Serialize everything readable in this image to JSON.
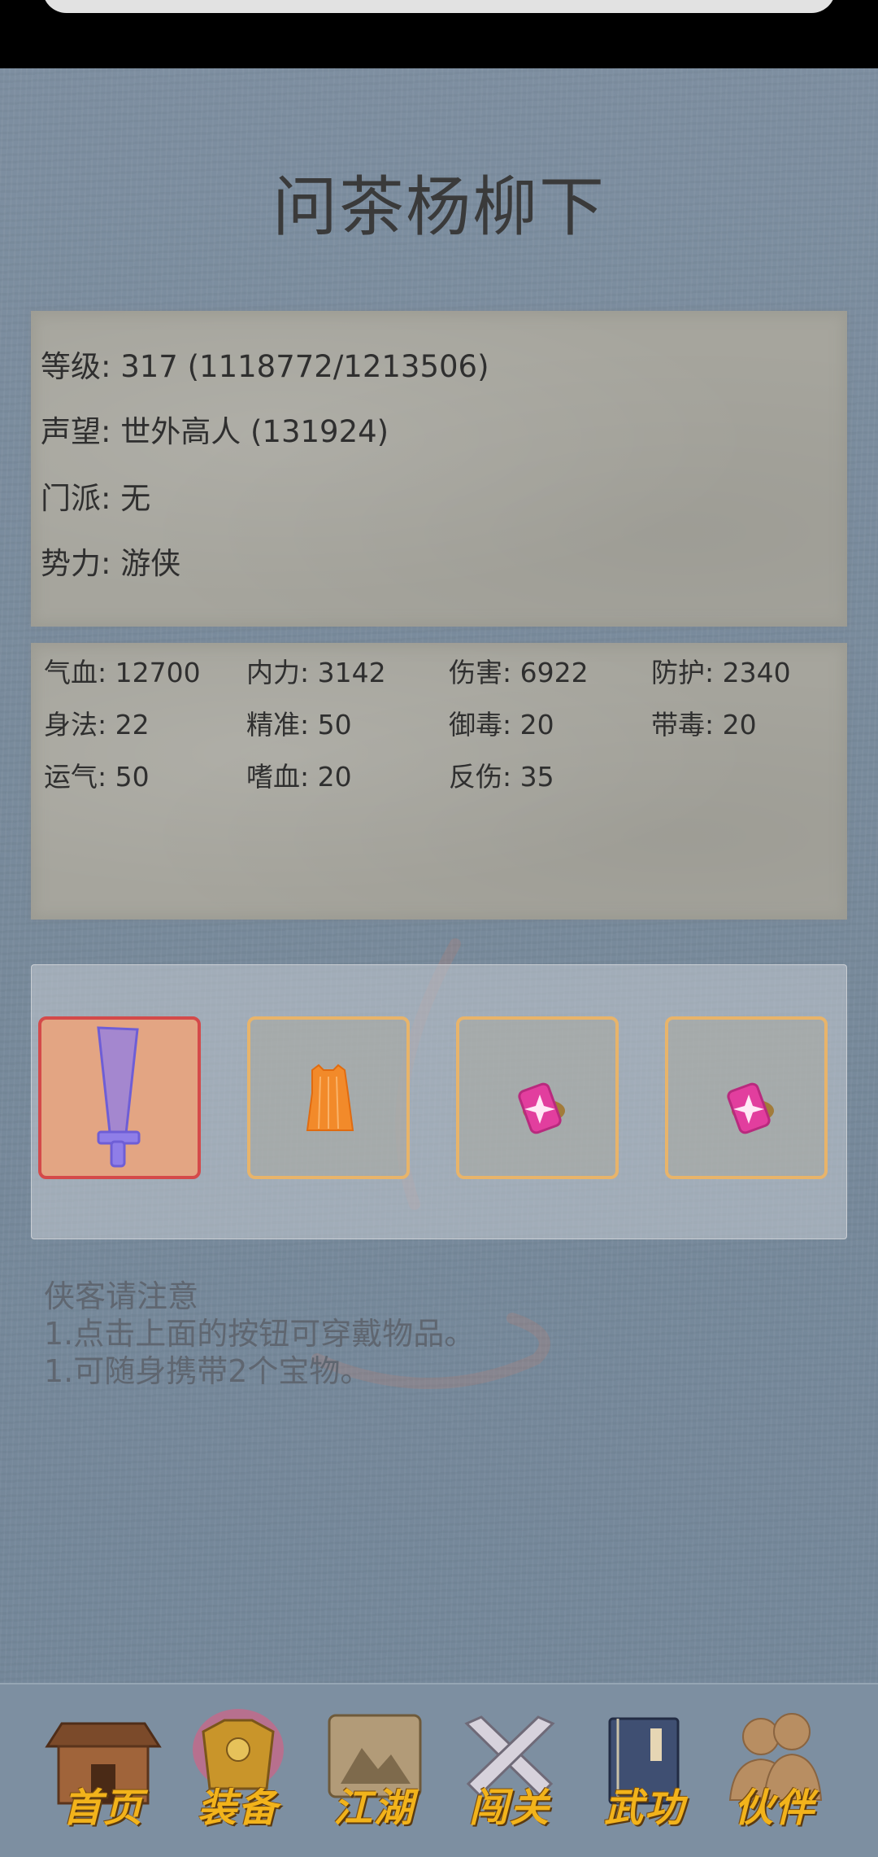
{
  "character": {
    "name": "问茶杨柳下",
    "level": "等级: 317 (1118772/1213506)",
    "prestige": "声望: 世外高人 (131924)",
    "sect": "门派: 无",
    "faction": "势力:  游侠"
  },
  "stats": [
    "气血: 12700",
    "内力: 3142",
    "伤害: 6922",
    "防护: 2340",
    "身法: 22",
    "精准: 50",
    "御毒: 20",
    "带毒: 20",
    "运气: 50",
    "嗜血: 20",
    "反伤: 35"
  ],
  "equipment": {
    "slots": [
      {
        "icon": "sword-icon",
        "active": true
      },
      {
        "icon": "armor-robe-icon",
        "active": false
      },
      {
        "icon": "treasure-gem-icon",
        "active": false
      },
      {
        "icon": "treasure-gem-icon",
        "active": false
      }
    ]
  },
  "notice": {
    "title": "侠客请注意",
    "line1": "1.点击上面的按钮可穿戴物品。",
    "line2": "1.可随身携带2个宝物。"
  },
  "nav": {
    "items": [
      {
        "label": "首页",
        "icon": "home-house-icon"
      },
      {
        "label": "装备",
        "icon": "armor-icon"
      },
      {
        "label": "江湖",
        "icon": "map-scroll-icon"
      },
      {
        "label": "闯关",
        "icon": "crossed-swords-icon"
      },
      {
        "label": "武功",
        "icon": "book-icon"
      },
      {
        "label": "伙伴",
        "icon": "partners-icon"
      }
    ]
  },
  "colors": {
    "background": "#7b8c9d",
    "panel": "#a6a59d",
    "slot_border": "#e8b46a",
    "active_slot_border": "#d44a4a",
    "nav_label": "#f2b31b"
  }
}
